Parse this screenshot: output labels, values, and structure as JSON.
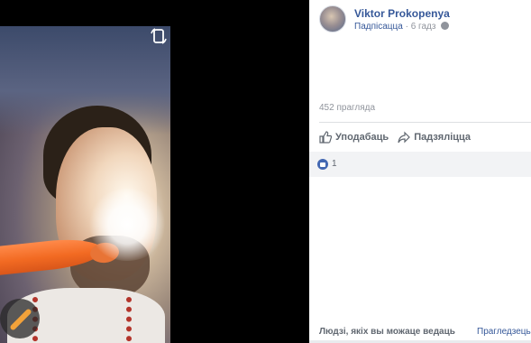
{
  "post": {
    "author": "Viktor Prokopenya",
    "follow_label": "Падпісацца",
    "separator": "·",
    "time": "6 гадз"
  },
  "stats": {
    "views": "452 прагляда"
  },
  "actions": {
    "like": "Уподабаць",
    "share": "Падзяліцца"
  },
  "reactions": {
    "count": "1"
  },
  "suggestions": {
    "title": "Людзі, якіх вы можаце ведаць",
    "see_all": "Прагледзець у"
  },
  "icons": {
    "rotate": "rotate-phone-icon",
    "globe": "globe-icon",
    "like": "thumbs-up-icon",
    "share": "share-arrow-icon",
    "reaction": "like-reaction-icon",
    "paint": "paintbrush-icon"
  },
  "colors": {
    "link": "#365899",
    "muted": "#90949c",
    "like_blue": "#4267b2",
    "accent_orange": "#f26a22"
  }
}
